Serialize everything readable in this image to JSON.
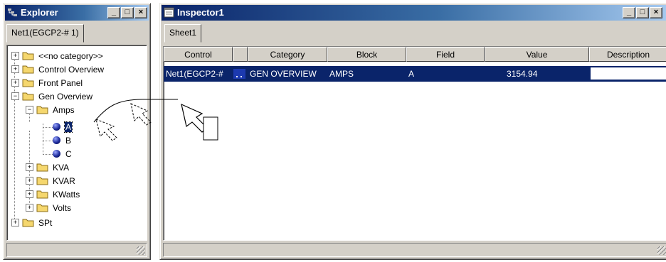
{
  "explorer": {
    "title": "Explorer",
    "tab": "Net1(EGCP2-# 1)",
    "tree": [
      {
        "label": "<<no category>>",
        "exp": "+"
      },
      {
        "label": "Control Overview",
        "exp": "+"
      },
      {
        "label": "Front Panel",
        "exp": "+"
      },
      {
        "label": "Gen Overview",
        "exp": "−"
      },
      {
        "label": "Amps",
        "exp": "−"
      },
      {
        "label": "A"
      },
      {
        "label": "B"
      },
      {
        "label": "C"
      },
      {
        "label": "KVA",
        "exp": "+"
      },
      {
        "label": "KVAR",
        "exp": "+"
      },
      {
        "label": "KWatts",
        "exp": "+"
      },
      {
        "label": "Volts",
        "exp": "+"
      },
      {
        "label": "SPt",
        "exp": "+"
      }
    ]
  },
  "inspector": {
    "title": "Inspector1",
    "tab": "Sheet1",
    "columns": [
      "Control",
      "",
      "Category",
      "Block",
      "Field",
      "Value",
      "Description"
    ],
    "row": {
      "control": "Net1(EGCP2-#",
      "category": "GEN OVERVIEW",
      "block": "AMPS",
      "field": "A",
      "value": "3154.94",
      "description": ""
    }
  },
  "window_buttons": {
    "minimize": "_",
    "maximize": "□",
    "close": "×"
  },
  "colors": {
    "titlebar": "#0a246a",
    "selection": "#0a246a",
    "chrome": "#d4d0c8"
  }
}
